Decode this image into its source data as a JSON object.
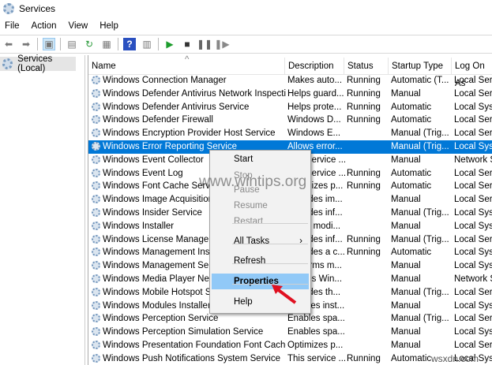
{
  "window": {
    "title": "Services",
    "icon": "gear-icon"
  },
  "menubar": [
    "File",
    "Action",
    "View",
    "Help"
  ],
  "toolbar": {
    "icons": [
      "back-icon",
      "forward-icon",
      "show-hide-console-tree-icon",
      "properties-icon",
      "refresh-icon",
      "export-list-icon",
      "help-icon",
      "action-pane-icon",
      "start-service-icon",
      "stop-service-icon",
      "pause-service-icon",
      "resume-service-icon"
    ]
  },
  "tree": {
    "selected": "Services (Local)"
  },
  "columns": [
    "Name",
    "Description",
    "Status",
    "Startup Type",
    "Log On As"
  ],
  "rows": [
    [
      "Windows Connection Manager",
      "Makes auto...",
      "Running",
      "Automatic (T...",
      "Local Serv"
    ],
    [
      "Windows Defender Antivirus Network Inspecti...",
      "Helps guard...",
      "Running",
      "Manual",
      "Local Serv"
    ],
    [
      "Windows Defender Antivirus Service",
      "Helps prote...",
      "Running",
      "Automatic",
      "Local Syst"
    ],
    [
      "Windows Defender Firewall",
      "Windows D...",
      "Running",
      "Automatic",
      "Local Serv"
    ],
    [
      "Windows Encryption Provider Host Service",
      "Windows E...",
      "",
      "Manual (Trig...",
      "Local Serv"
    ],
    [
      "Windows Error Reporting Service",
      "Allows error...",
      "",
      "Manual (Trig...",
      "Local Syst"
    ],
    [
      "Windows Event Collector",
      "This service ...",
      "",
      "Manual",
      "Network S"
    ],
    [
      "Windows Event Log",
      "This service ...",
      "Running",
      "Automatic",
      "Local Serv"
    ],
    [
      "Windows Font Cache Service",
      "Optimizes p...",
      "Running",
      "Automatic",
      "Local Serv"
    ],
    [
      "Windows Image Acquisition (WIA)",
      "Provides im...",
      "",
      "Manual",
      "Local Serv"
    ],
    [
      "Windows Insider Service",
      "Provides inf...",
      "",
      "Manual (Trig...",
      "Local Syst"
    ],
    [
      "Windows Installer",
      "Adds, modi...",
      "",
      "Manual",
      "Local Syst"
    ],
    [
      "Windows License Manager Service",
      "Provides inf...",
      "Running",
      "Manual (Trig...",
      "Local Serv"
    ],
    [
      "Windows Management Instrumentation",
      "Provides a c...",
      "Running",
      "Automatic",
      "Local Syst"
    ],
    [
      "Windows Management Service",
      "Performs m...",
      "",
      "Manual",
      "Local Syst"
    ],
    [
      "Windows Media Player Network Sharing Service",
      "Shares Win...",
      "",
      "Manual",
      "Network S"
    ],
    [
      "Windows Mobile Hotspot Service",
      "Provides th...",
      "",
      "Manual (Trig...",
      "Local Serv"
    ],
    [
      "Windows Modules Installer",
      "Enables inst...",
      "",
      "Manual",
      "Local Syst"
    ],
    [
      "Windows Perception Service",
      "Enables spa...",
      "",
      "Manual (Trig...",
      "Local Serv"
    ],
    [
      "Windows Perception Simulation Service",
      "Enables spa...",
      "",
      "Manual",
      "Local Syst"
    ],
    [
      "Windows Presentation Foundation Font Cache ...",
      "Optimizes p...",
      "",
      "Manual",
      "Local Serv"
    ],
    [
      "Windows Push Notifications System Service",
      "This service ...",
      "Running",
      "Automatic",
      "Local Syst"
    ]
  ],
  "selected_row": 5,
  "context_menu": {
    "items": [
      {
        "label": "Start",
        "enabled": true
      },
      {
        "label": "Stop",
        "enabled": false
      },
      {
        "label": "Pause",
        "enabled": false
      },
      {
        "label": "Resume",
        "enabled": false
      },
      {
        "label": "Restart",
        "enabled": false
      },
      {
        "label": "All Tasks",
        "enabled": true,
        "submenu": true
      },
      {
        "label": "Refresh",
        "enabled": true
      },
      {
        "label": "Properties",
        "enabled": true,
        "highlighted": true
      },
      {
        "label": "Help",
        "enabled": true
      }
    ]
  },
  "watermarks": [
    "www.wintips.org",
    "wsxdn.com"
  ],
  "colors": {
    "selection": "#0078d7",
    "menu_highlight": "#91c9f7",
    "arrow": "#e01020"
  }
}
